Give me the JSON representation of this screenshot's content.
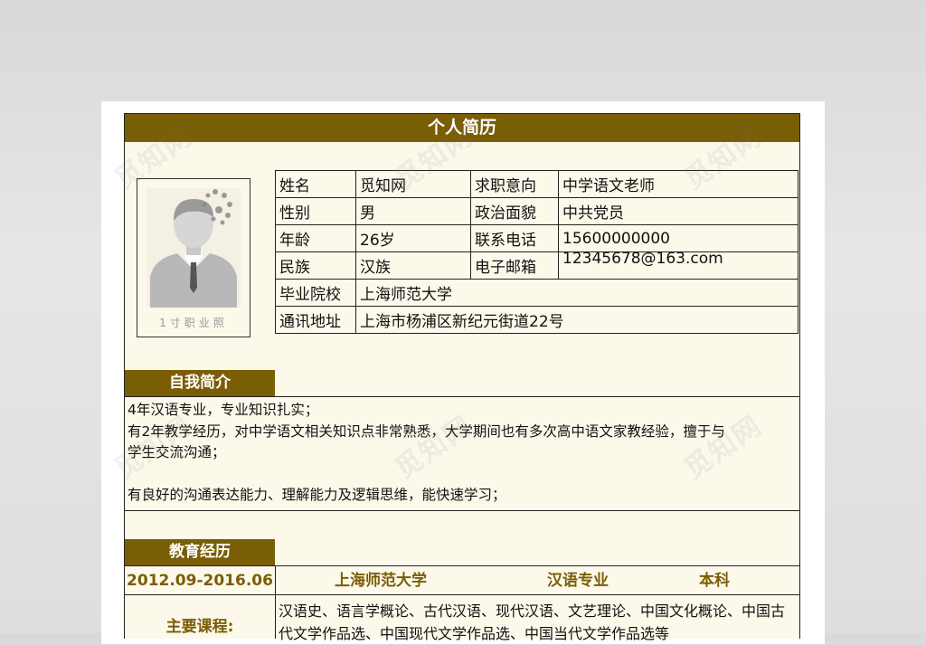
{
  "resume": {
    "title": "个人简历",
    "photo_caption": "1寸职业照",
    "info_rows": [
      {
        "label": "姓名",
        "value": "觅知网",
        "label2": "求职意向",
        "value2": "中学语文老师"
      },
      {
        "label": "性别",
        "value": "男",
        "label2": "政治面貌",
        "value2": "中共党员"
      },
      {
        "label": "年龄",
        "value": "26岁",
        "label2": "联系电话",
        "value2": "15600000000"
      },
      {
        "label": "民族",
        "value": "汉族",
        "label2": "电子邮箱",
        "value2": "12345678@163.com"
      }
    ],
    "school_label": "毕业院校",
    "school_value": "上海师范大学",
    "address_label": "通讯地址",
    "address_value": "上海市杨浦区新纪元街道22号",
    "intro_heading": "自我简介",
    "intro_lines": [
      "4年汉语专业，专业知识扎实；",
      "有2年教学经历，对中学语文相关知识点非常熟悉，大学期间也有多次高中语文家教经验，擅于与",
      "学生交流沟通；",
      "",
      "有良好的沟通表达能力、理解能力及逻辑思维，能快速学习；"
    ],
    "edu_heading": "教育经历",
    "edu": {
      "period": "2012.09-2016.06",
      "school": "上海师范大学",
      "major": "汉语专业",
      "degree": "本科"
    },
    "course_label": "主要课程:",
    "course_text": "汉语史、语言学概论、古代汉语、现代汉语、文艺理论、中国文化概论、中国古代文学作品选、中国现代文学作品选、中国当代文学作品选等"
  },
  "watermark": "觅知网",
  "colors": {
    "accent": "#7a5e06",
    "paper": "#fcf8ea"
  },
  "icons": {
    "photo": "person-silhouette-icon"
  }
}
